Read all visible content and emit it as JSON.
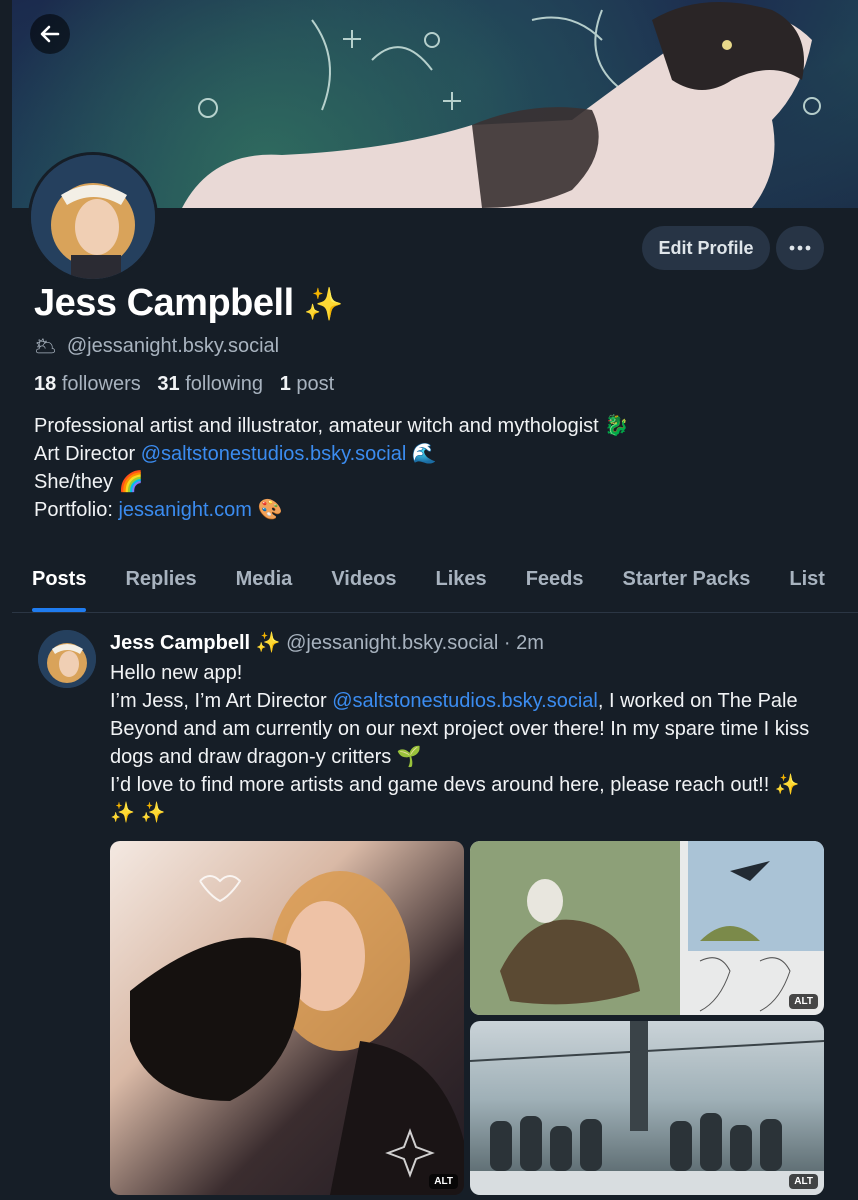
{
  "profile": {
    "name": "Jess Campbell",
    "name_emoji": "✨",
    "handle_emoji": "🌥",
    "handle": "@jessanight.bsky.social",
    "edit_label": "Edit Profile",
    "more_label": "•••",
    "stats": {
      "followers_count": "18",
      "followers_label": "followers",
      "following_count": "31",
      "following_label": "following",
      "posts_count": "1",
      "posts_label": "post"
    },
    "bio": {
      "line1": "Professional artist and illustrator, amateur witch and mythologist",
      "line1_emoji": "🐉",
      "line2_prefix": "Art Director ",
      "line2_link": "@saltstonestudios.bsky.social",
      "line2_emoji": "🌊",
      "line3": "She/they",
      "line3_emoji": "🌈",
      "line4_prefix": "Portfolio: ",
      "line4_link": "jessanight.com",
      "line4_emoji": "🎨"
    }
  },
  "tabs": [
    {
      "label": "Posts",
      "active": true
    },
    {
      "label": "Replies"
    },
    {
      "label": "Media"
    },
    {
      "label": "Videos"
    },
    {
      "label": "Likes"
    },
    {
      "label": "Feeds"
    },
    {
      "label": "Starter Packs"
    },
    {
      "label": "List"
    }
  ],
  "post": {
    "author_name": "Jess Campbell",
    "author_emoji": "✨",
    "author_handle": "@jessanight.bsky.social",
    "separator": "·",
    "time": "2m",
    "line1": "Hello new app!",
    "line2_prefix": "I’m Jess, I’m Art Director ",
    "line2_link": "@saltstonestudios.bsky.social",
    "line2_suffix": ", I worked on The Pale Beyond and am currently on our next project over there! In my spare time I kiss dogs and draw dragon-y critters 🌱",
    "line3": "I’d love to find more artists and game devs around here, please reach out!! ✨ ✨ ✨",
    "alt_label": "ALT"
  },
  "colors": {
    "background": "#161e27",
    "accent": "#1f7cf0",
    "link": "#3b8cf0",
    "muted": "#a8b3bf"
  },
  "icons": {
    "back": "arrow-left-icon",
    "more": "ellipsis-icon"
  }
}
